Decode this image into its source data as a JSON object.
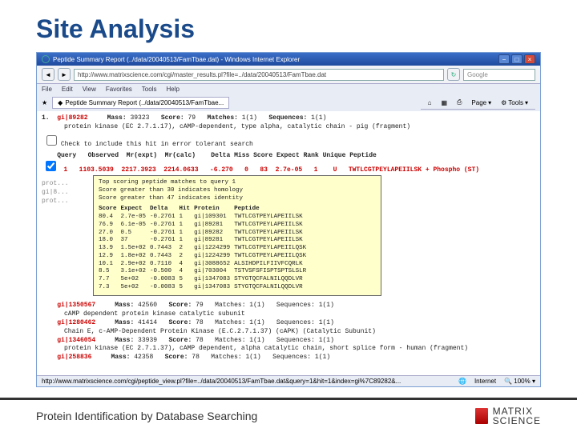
{
  "slide": {
    "title": "Site Analysis",
    "footer": "Protein Identification by Database Searching",
    "logo1": "MATRIX",
    "logo2": "SCIENCE"
  },
  "win": {
    "title": "Peptide Summary Report (../data/20040513/FamTbae.dat) - Windows Internet Explorer",
    "url": "http://www.matrixscience.com/cgi/master_results.pl?file=../data/20040513/FamTbae.dat",
    "search_ph": "Google"
  },
  "menu": [
    "File",
    "Edit",
    "View",
    "Favorites",
    "Tools",
    "Help"
  ],
  "tab": {
    "label": "Peptide Summary Report (../data/20040513/FamTbae..."
  },
  "toolbar": [
    "Page",
    "Tools"
  ],
  "entry": {
    "acc": "gi|89282",
    "mass": "39323",
    "score": "79",
    "matches": "1(1)",
    "seq": "1(1)",
    "desc": "protein kinase (EC 2.7.1.17), cAMP-dependent, type alpha, catalytic chain - pig (fragment)",
    "check": "Check to include this hit in error tolerant search"
  },
  "hdr": [
    "Query",
    "Observed",
    "Mr(expt)",
    "Mr(calc)",
    "Delta",
    "Miss",
    "Score",
    "Expect",
    "Rank",
    "Unique",
    "Peptide"
  ],
  "row": {
    "q": "1",
    "obs": "1103.5039",
    "exp": "2217.3923",
    "calc": "2214.0633",
    "delta": "-6.270",
    "miss": "0",
    "score": "83",
    "expect": "2.7e-05",
    "rank": "1",
    "unique": "U",
    "pep": "TWTLCGTPEYLAPEIILSK + Phospho (ST)"
  },
  "others": [
    {
      "acc": "gi|1350567",
      "mass": "42560",
      "score": "79",
      "m": "Matches: 1(1)",
      "s": "Sequences: 1(1)",
      "desc": "cAMP dependent protein kinase catalytic subunit"
    },
    {
      "acc": "gi|1280462",
      "mass": "41414",
      "score": "78",
      "m": "Matches: 1(1)",
      "s": "Sequences: 1(1)",
      "desc": "Chain E, c-AMP-Dependent Protein Kinase (E.C.2.7.1.37) (cAPK) (Catalytic Subunit)"
    },
    {
      "acc": "gi|1346054",
      "mass": "33939",
      "score": "78",
      "m": "Matches: 1(1)",
      "s": "Sequences: 1(1)",
      "desc": "protein kinase (EC 2.7.1.37), cAMP dependent, alpha catalytic chain, short splice form - human (fragment)"
    },
    {
      "acc": "gi|258836",
      "mass": "42358",
      "score": "78",
      "m": "Matches: 1(1)",
      "s": "Sequences: 1(1)",
      "desc": ""
    }
  ],
  "popup": {
    "l1": "Top scoring peptide matches to query 1",
    "l2": "Score greater than 30 indicates homology",
    "l3": "Score greater than 47 indicates identity",
    "cols": [
      "Score",
      "Expect",
      "Delta",
      "Hit",
      "Protein",
      "Peptide"
    ],
    "rows": [
      [
        "80.4",
        "2.7e-05",
        "-0.2761",
        "1",
        "gi|109301",
        "TWTLCGTPEYLAPEIILSK"
      ],
      [
        "76.9",
        "6.1e-05",
        "-0.2761",
        "1",
        "gi|89281",
        "TWTLCGTPEYLAPEIILSK"
      ],
      [
        "27.0",
        "0.5",
        "-0.2761",
        "1",
        "gi|89282",
        "TWTLCGTPEYLAPEIILSK"
      ],
      [
        "18.0",
        "37",
        "-0.2761",
        "1",
        "gi|89281",
        "TWTLCGTPEYLAPEIILSK"
      ],
      [
        "13.9",
        "1.5e+02",
        "0.7443",
        "2",
        "gi|1224299",
        "TWTLCGTPEYLAPEIILQSK"
      ],
      [
        "12.9",
        "1.8e+02",
        "0.7443",
        "2",
        "gi|1224299",
        "TWTLCGTPEYLAPEIILQSK"
      ],
      [
        "10.1",
        "2.9e+02",
        "0.7110",
        "4",
        "gi|3088652",
        "ALSIHDPILFIIVFCQRLK"
      ],
      [
        "8.5",
        "3.1e+02",
        "-0.500",
        "4",
        "gi|703004",
        "TSTVSFSFISPTSPTSLSLR"
      ],
      [
        "7.7",
        "5e+02",
        "-0.0083",
        "5",
        "gi|1347083",
        "STYGTQCFALNILQQDLVR"
      ],
      [
        "7.3",
        "5e+02",
        "-0.0083",
        "5",
        "gi|1347083",
        "STYGTQCFALNILQQDLVR"
      ]
    ]
  },
  "status": {
    "url": "http://www.matrixscience.com/cgi/peptide_view.pl?file=../data/20040513/FamTbae.dat&query=1&hit=1&index=gi%7C89282&...",
    "zone": "Internet",
    "zoom": "100%"
  }
}
